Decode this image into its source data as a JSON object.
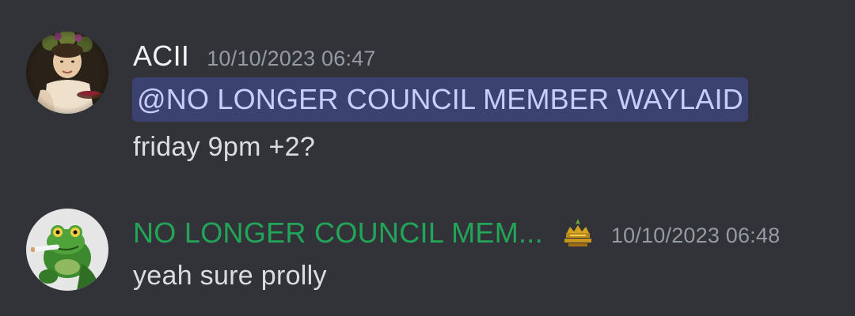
{
  "messages": [
    {
      "username": "ACII",
      "username_color": "#f2f3f5",
      "timestamp": "10/10/2023 06:47",
      "mention": "@NO LONGER COUNCIL MEMBER WAYLAID",
      "text": "friday 9pm +2?",
      "avatar_icon": "renaissance-painting-avatar"
    },
    {
      "username": "NO LONGER COUNCIL MEM...",
      "username_color": "#23a559",
      "timestamp": "10/10/2023 06:48",
      "role_icon": "crown-badge-icon",
      "text": "yeah sure prolly",
      "avatar_icon": "frog-smoking-avatar"
    }
  ],
  "colors": {
    "background": "#313338",
    "timestamp": "#949ba4",
    "mention_bg": "#3c4270",
    "mention_text": "#c9cdfb",
    "message_text": "#dbdee1"
  }
}
